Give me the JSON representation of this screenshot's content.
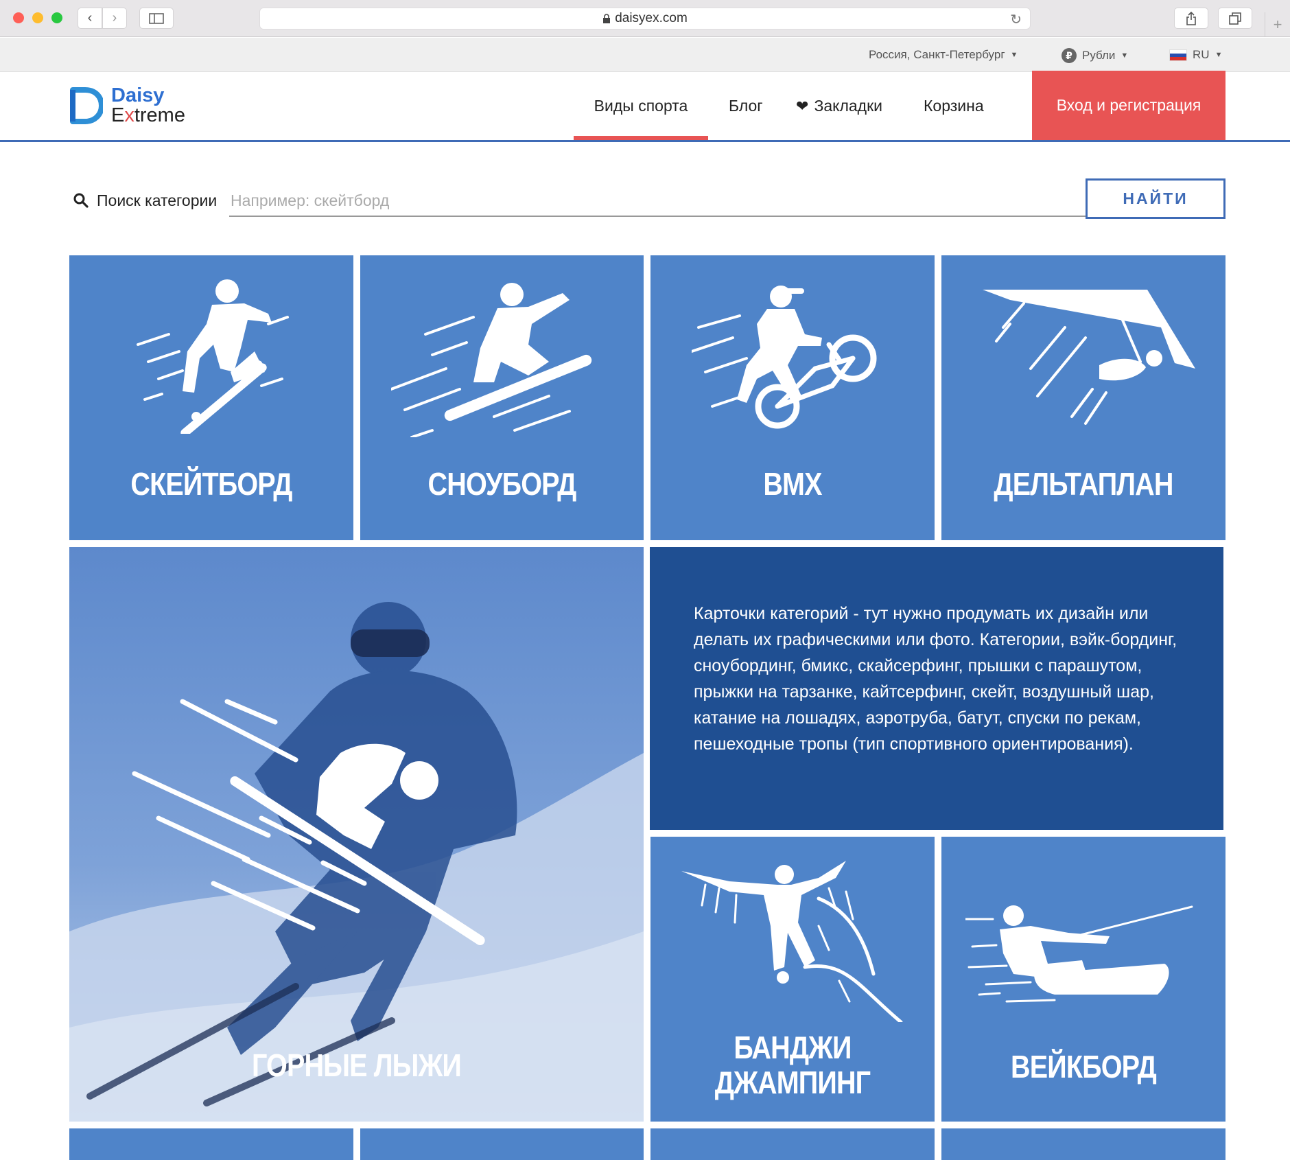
{
  "browser": {
    "url": "daisyex.com"
  },
  "utilbar": {
    "region": "Россия, Санкт-Петербург",
    "currency": "Рубли",
    "language": "RU"
  },
  "header": {
    "logo_line1": "Daisy",
    "logo_line2_pre": "E",
    "logo_line2_x": "x",
    "logo_line2_post": "treme",
    "nav": {
      "sports": "Виды спорта",
      "blog": "Блог",
      "bookmarks": "Закладки",
      "cart": "Корзина"
    },
    "login": "Вход и регистрация"
  },
  "search": {
    "label": "Поиск категории",
    "placeholder": "Например: скейтборд",
    "button": "НАЙТИ"
  },
  "tiles": {
    "skateboard": "СКЕЙТБОРД",
    "snowboard": "СНОУБОРД",
    "bmx": "BMX",
    "hangglider": "ДЕЛЬТАПЛАН",
    "ski": "ГОРНЫЕ ЛЫЖИ",
    "bungee_line1": "БАНДЖИ",
    "bungee_line2": "ДЖАМПИНГ",
    "wakeboard": "ВЕЙКБОРД"
  },
  "info_text": "Карточки категорий - тут нужно продумать их дизайн или делать их графическими или фото. Категории, вэйк-бординг, сноубординг, бмикс, скайсерфинг, прышки с парашутом, прыжки на тарзанке, кайтсерфинг, скейт, воздушный шар, катание на лошадях, аэротруба, батут, спуски по рекам, пешеходные тропы (тип спортивного ориентирования).",
  "colors": {
    "tile": "#4f84c9",
    "info": "#1f4f92",
    "accent": "#e85454",
    "brand": "#3f6bb6"
  }
}
